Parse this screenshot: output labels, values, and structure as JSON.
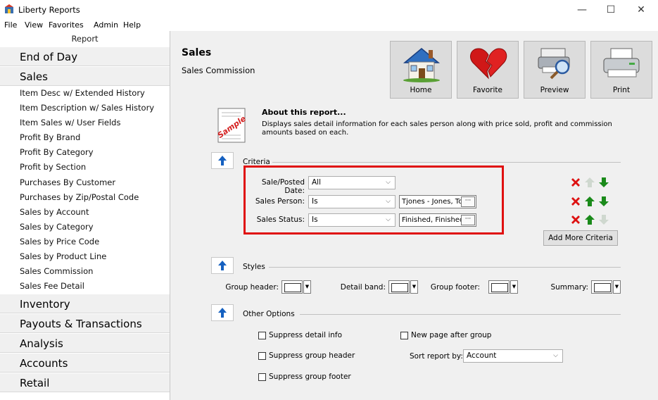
{
  "window": {
    "title": "Liberty Reports",
    "min": "—",
    "max": "☐",
    "close": "✕"
  },
  "menu": [
    "File",
    "View",
    "Favorites",
    "Admin",
    "Help"
  ],
  "sidebar": {
    "header": "Report",
    "categories_top": [
      "End of Day",
      "Sales"
    ],
    "items": [
      "Item Desc w/ Extended History",
      "Item Description w/ Sales History",
      "Item Sales w/ User Fields",
      "Profit By Brand",
      "Profit By Category",
      "Profit by Section",
      "Purchases By Customer",
      "Purchases by Zip/Postal Code",
      "Sales by Account",
      "Sales by Category",
      "Sales by Price Code",
      "Sales by Product Line",
      "Sales Commission",
      "Sales Fee Detail"
    ],
    "categories_bottom": [
      "Inventory",
      "Payouts & Transactions",
      "Analysis",
      "Accounts",
      "Retail"
    ]
  },
  "report": {
    "title": "Sales",
    "subtitle": "Sales Commission"
  },
  "toolbar": {
    "home": "Home",
    "favorite": "Favorite",
    "preview": "Preview",
    "print": "Print"
  },
  "about": {
    "icon_text": "Sample",
    "title": "About this report...",
    "description": "Displays sales detail information for each sales person along with price sold, profit and commission amounts based on each."
  },
  "criteria": {
    "section_label": "Criteria",
    "rows": [
      {
        "label": "Sale/Posted Date:",
        "operator": "All"
      },
      {
        "label": "Sales Person:",
        "operator": "Is",
        "value": "Tjones - Jones, Tc"
      },
      {
        "label": "Sales Status:",
        "operator": "Is",
        "value": "Finished, Finished"
      }
    ],
    "ellipsis": "···",
    "add_more": "Add More Criteria"
  },
  "styles": {
    "section_label": "Styles",
    "group_header": "Group header:",
    "detail_band": "Detail band:",
    "group_footer": "Group footer:",
    "summary": "Summary:"
  },
  "options": {
    "section_label": "Other Options",
    "suppress_detail": "Suppress detail info",
    "suppress_group_header": "Suppress group header",
    "suppress_group_footer": "Suppress group footer",
    "new_page": "New page after group",
    "sort_label": "Sort report by:",
    "sort_value": "Account"
  },
  "colors": {
    "highlight": "#e01010",
    "delete_red": "#dd1111",
    "arrow_green": "#1a8a1a",
    "arrow_blue": "#1560c0"
  }
}
